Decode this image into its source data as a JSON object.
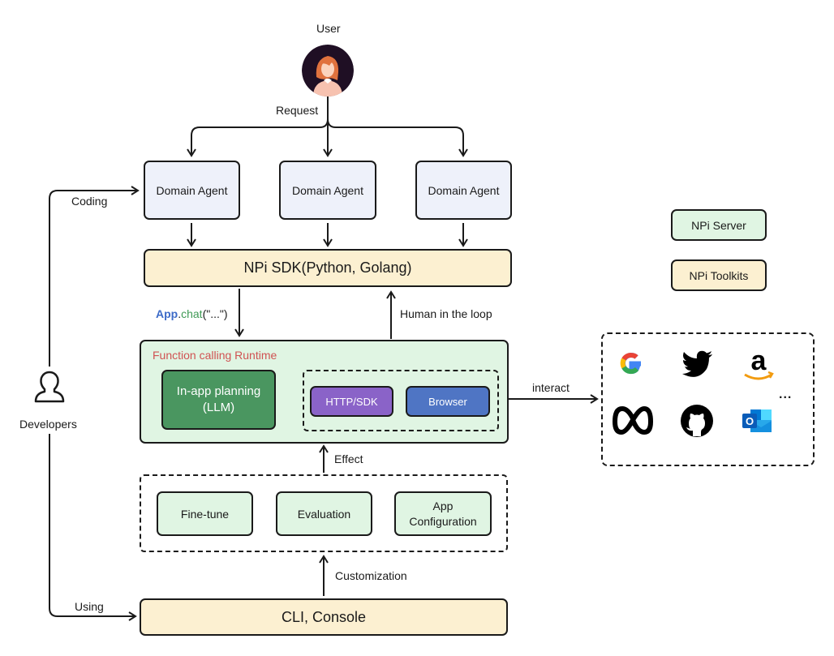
{
  "user": {
    "label": "User",
    "request_label": "Request"
  },
  "agents": [
    {
      "label": "Domain Agent"
    },
    {
      "label": "Domain Agent"
    },
    {
      "label": "Domain Agent"
    }
  ],
  "sdk": {
    "label": "NPi SDK(Python, Golang)"
  },
  "legend": {
    "items": [
      {
        "label": "NPi Server",
        "color": "#e0f5e3"
      },
      {
        "label": "NPi Toolkits",
        "color": "#fcf0d1"
      }
    ]
  },
  "flow_labels": {
    "app": "App",
    "dot": ".",
    "chat": "chat",
    "args": "(\"...\")",
    "human_loop": "Human in the loop",
    "interact": "interact",
    "effect": "Effect",
    "customization": "Customization",
    "coding": "Coding",
    "using": "Using"
  },
  "runtime": {
    "title": "Function calling Runtime",
    "planner": {
      "line1": "In-app planning",
      "line2": "(LLM)"
    },
    "tools": [
      {
        "label": "HTTP/SDK",
        "color": "#8a63c8"
      },
      {
        "label": "Browser",
        "color": "#4f75c4"
      }
    ]
  },
  "customization_group": {
    "items": [
      {
        "label": "Fine-tune"
      },
      {
        "label": "Evaluation"
      },
      {
        "line1": "App",
        "line2": "Configuration"
      }
    ]
  },
  "console": {
    "label": "CLI, Console"
  },
  "developers": {
    "label": "Developers"
  },
  "integrations": {
    "icons": [
      "google-icon",
      "twitter-icon",
      "amazon-icon",
      "meta-icon",
      "github-icon",
      "outlook-icon"
    ],
    "more": "..."
  },
  "colors": {
    "app_blue": "#3d6bc8",
    "chat_green": "#3f9a55",
    "runtime_title": "#d05252",
    "planner_green": "#4a9660"
  }
}
